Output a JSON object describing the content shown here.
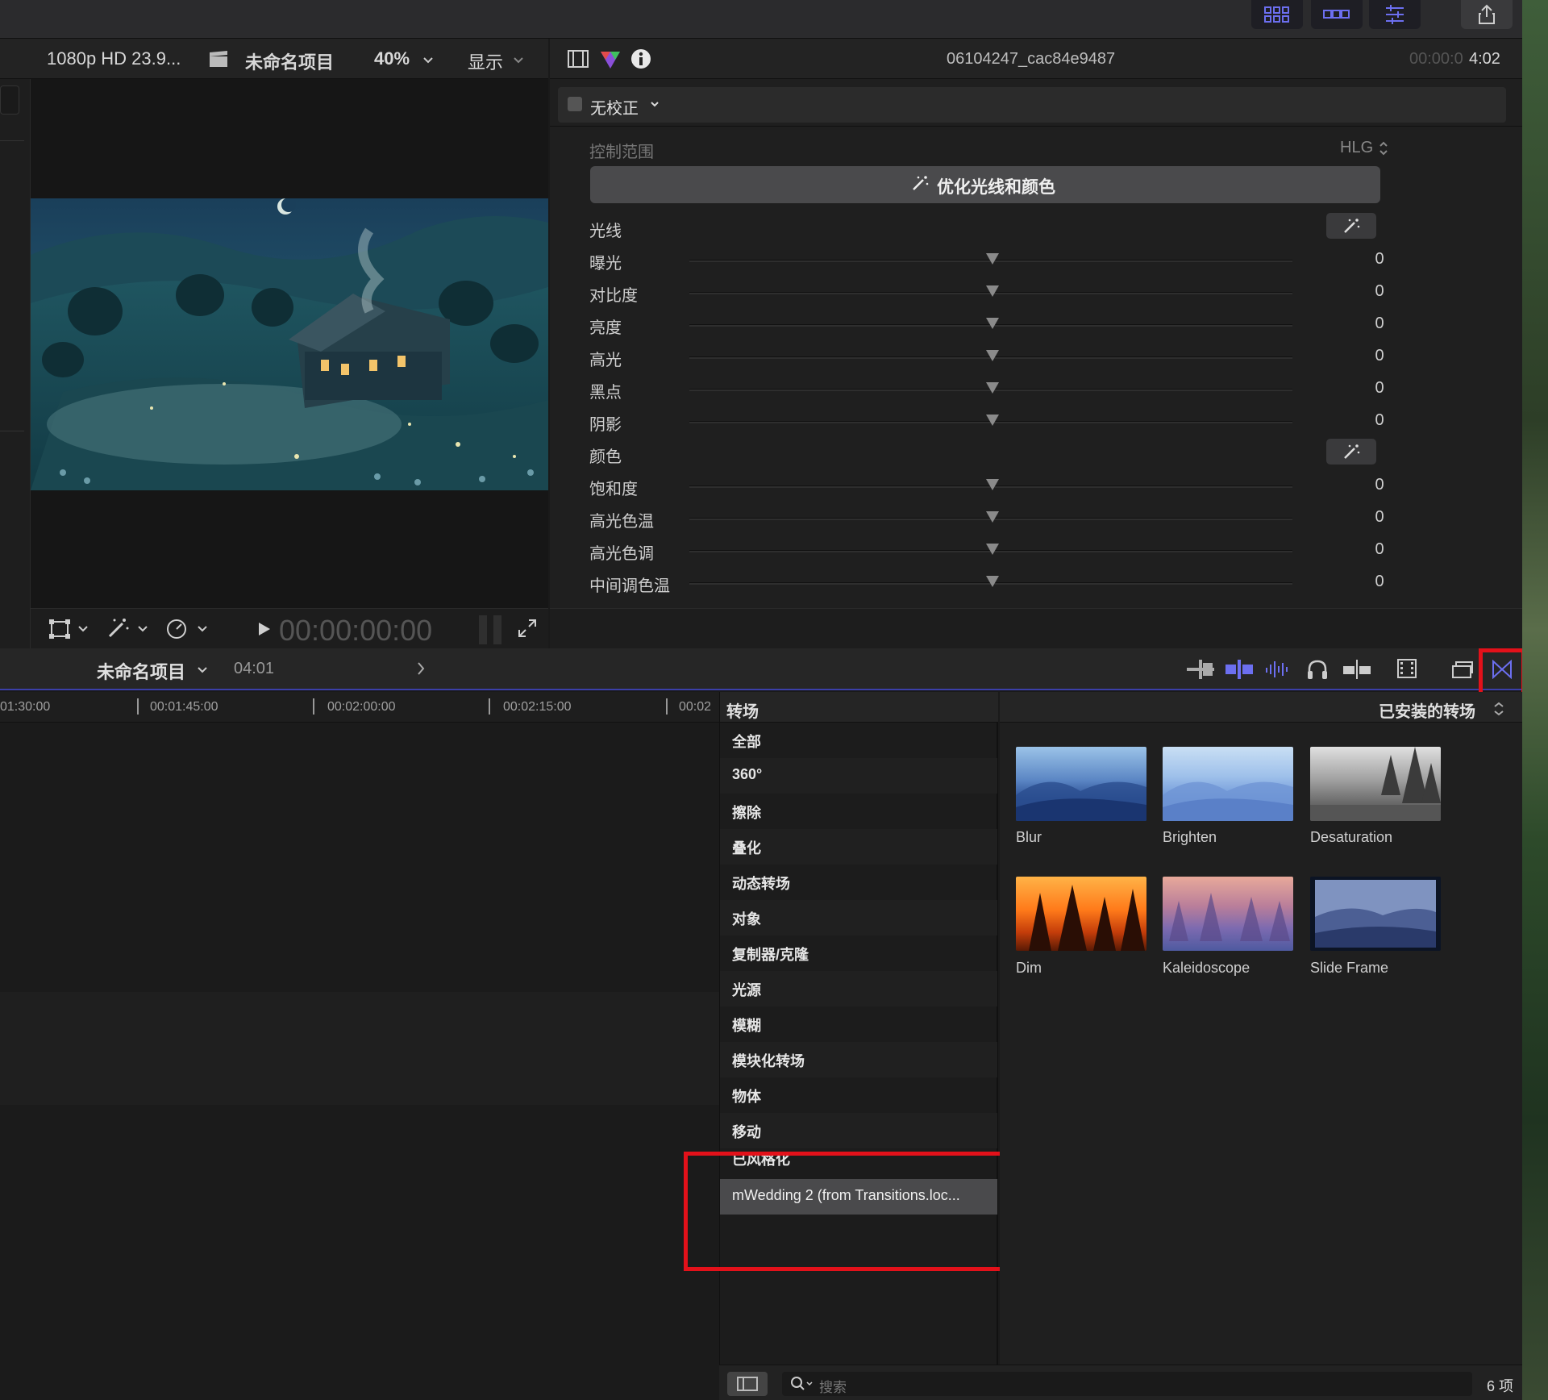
{
  "viewer": {
    "format": "1080p HD 23.9...",
    "project": "未命名项目",
    "zoom": "40%",
    "display": "显示",
    "timecode": "00:00:00:00"
  },
  "inspector": {
    "clip_name": "06104247_cac84e9487",
    "timecode_dim": "00:00:0",
    "timecode_bright": "4:02",
    "correction": "无校正",
    "control_range_label": "控制范围",
    "control_range_value": "HLG",
    "enhance_button": "优化光线和颜色",
    "sections": {
      "light": "光线",
      "color": "颜色"
    },
    "sliders_light": [
      {
        "label": "曝光",
        "value": "0"
      },
      {
        "label": "对比度",
        "value": "0"
      },
      {
        "label": "亮度",
        "value": "0"
      },
      {
        "label": "高光",
        "value": "0"
      },
      {
        "label": "黑点",
        "value": "0"
      },
      {
        "label": "阴影",
        "value": "0"
      }
    ],
    "sliders_color": [
      {
        "label": "饱和度",
        "value": "0"
      },
      {
        "label": "高光色温",
        "value": "0"
      },
      {
        "label": "高光色调",
        "value": "0"
      },
      {
        "label": "中间调色温",
        "value": "0"
      }
    ]
  },
  "timeline": {
    "project": "未命名项目",
    "duration": "04:01",
    "ruler": [
      "01:30:00",
      "00:01:45:00",
      "00:02:00:00",
      "00:02:15:00",
      "00:02"
    ]
  },
  "browser": {
    "title": "转场",
    "filter": "已安装的转场",
    "categories": [
      "全部",
      "360°",
      "擦除",
      "叠化",
      "动态转场",
      "对象",
      "复制器/克隆",
      "光源",
      "模糊",
      "模块化转场",
      "物体",
      "移动",
      "已风格化",
      "mWedding 2 (from Transitions.loc..."
    ],
    "selected_index": 13,
    "transitions": [
      "Blur",
      "Brighten",
      "Desaturation",
      "Dim",
      "Kaleidoscope",
      "Slide Frame"
    ],
    "search_placeholder": "搜索",
    "count": "6 项"
  },
  "colors": {
    "accent": "#5b5fe0",
    "highlight": "#e3111a"
  }
}
